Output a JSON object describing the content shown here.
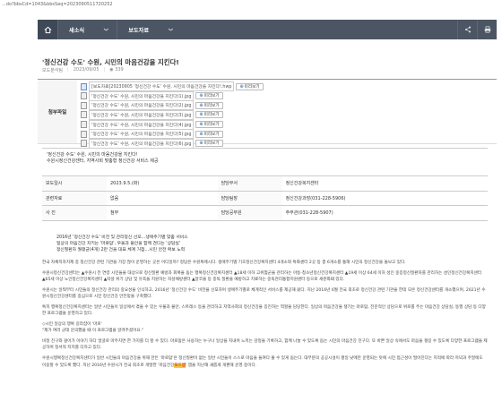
{
  "url": "...do?bbsCd=1043&bbsSeq=2023090511720252",
  "nav": {
    "crumbs": [
      "새소식",
      "보도자료"
    ]
  },
  "article": {
    "title": "'정신건강 수도' 수원, 시민의 마음건강을 지킨다!",
    "department": "보도분석팀",
    "date": "2023/09/05",
    "views": "339"
  },
  "attach": {
    "label": "첨부파일",
    "files": [
      {
        "name": "[보도자료]20230905 '정신건강 수도' 수원, 시민의 마음건강을 지킨다!.hwp",
        "type": "hwp",
        "download": "다운로드",
        "preview": "미리보기"
      },
      {
        "name": "'정신건강 수도' 수원, 시민의 마음건강을 지킨다(1).jpg",
        "type": "jpg",
        "download": "다운로드",
        "preview": "미리보기"
      },
      {
        "name": "'정신건강 수도' 수원, 시민의 마음건강을 지킨다(2).jpg",
        "type": "jpg",
        "download": "다운로드",
        "preview": "미리보기"
      },
      {
        "name": "'정신건강 수도' 수원, 시민의 마음건강을 지킨다(3).jpg",
        "type": "jpg",
        "download": "다운로드",
        "preview": "미리보기"
      },
      {
        "name": "'정신건강 수도' 수원, 시민의 마음건강을 지킨다(4).jpg",
        "type": "jpg",
        "download": "다운로드",
        "preview": "미리보기"
      },
      {
        "name": "'정신건강 수도' 수원, 시민의 마음건강을 지킨다(5).jpg",
        "type": "jpg",
        "download": "다운로드",
        "preview": "미리보기"
      },
      {
        "name": "'정신건강 수도' 수원, 시민의 마음건강을 지킨다(6).jpg",
        "type": "jpg",
        "download": "다운로드",
        "preview": "미리보기"
      }
    ]
  },
  "lead": {
    "line1": "'정신건강 수도' 수원, 시민의 마음건강을 지킨다!",
    "line2": "수원시정신건강센터, 지역사회 맞춤형 정신건강 서비스 제공"
  },
  "info_table": [
    [
      "보도일시",
      "2023.9.5.(화)",
      "담당부서",
      "정신건강복지센터"
    ],
    [
      "관련자료",
      "없음",
      "담당팀장",
      "정신건강과장(031-228-5906)"
    ],
    [
      "사 진",
      "첨부",
      "담당공무원",
      "주무관(031-228-5907)"
    ]
  ],
  "summary": [
    "2016년 '정신건강 수도' 비전 및 관리정신 선포…생애주기별 맞춤 서비스",
    "일상의 마음건강 지키는 '마로맘', 우울과 불안을 함께 견디는 '상담실'",
    "정신질환자 월평균(4개) 2만 건을 대표 체계 거점…시민 안전 확보 노력"
  ],
  "paragraphs": [
    "한국 자체지자치제 중 정신건강 관련 기관을 가장 많이 운영하는 곳은 어디일까? 정답은 수원특례시다. 생애주기별 기초정신건강복지센터 4개소와 특화센터 2곳 등 총 6개소를 통해 시민의 정신건강을 돌보고 있다.",
    "수원시정신건강센터는 ▲수원시 전 연령 시민들을 대상으로 정신질환 예방과 회복을 돕는 행복정신건강복지센터 ▲18세 이하 고위험군을 관리하는 아동·청소년정신건강복지센터 ▲19세 이상 64세 이하 성인 중증정신질환자를 관리하는 성인정신건강복지센터 ▲65세 이상 노인정신건강복지센터 ▲자살 위기 상담 및 유족을 지원하는 자살예방센터 ▲알코올 등 중독 질환을 예방하고 치료하는 중독관리통합지원센터 등으로 세분화돼 있다.",
    "수원시는 일찍부터 시민들의 정신건강 관리의 중요성을 인식하고, 2016년 '정신건강 수도' 비전을 선포하며 생애주기별로 체계적인 서비스를 제공해 왔다. 지난 2016년 6월 전국 최초로 정신건강 관련 기관을 한데 모은 정신건강센터를 개소했으며, 2021년 수원시정신건강센터를 중심으로 시민 정신건강 안전망을 구축했다.",
    "특히 행복정신건강복지센터는 일반 시민들이 일상에서 겪을 수 있는 우울과 불안, 스트레스 등을 관리하고 지역사회의 정신건강을 증진하는 역할을 담당한다. 일상의 마음건강을 챙기는 마로맘, 전문적인 상담으로 위로를 주는 마음건강 상담실, 동행 상담 등 다양한 프로그램을 운영하고 있다.",
    "◇시민 일상의 행복 길라잡이 '마로'\n\"제가 여러 군데 문의했을 때 이 프로그램을 알려주셨어요.\"",
    "비정 친구와 걸어가 이야기 하다 얼굴로 마주치면 한 가지를 더 할 수 있다. 마로맘은 사용하는 누구나 일상을 지내며 느끼는 감정을 기록하고, 함께 나눌 수 있도록 돕는 시민의 마음건강 친구다. 또 바쁜 일상 속에서도 마음을 챙길 수 있도록 다양한 프로그램을 제공하며 정서적 지지를 더하고 있다.",
    "수원시행복정신건강복지센터가 일반 시민들의 마음건강을 위해 만든 '마로맘'은 정신질환이 없는 일반 시민들이 스스로 마음을 들여다 볼 수 있게 돕는다. 대부분의 공공시설이 평일 낮에만 운영되는 탓에 시민 접근성이 떨어진다는 지적에 따라 저녁과 주말에도 이용할 수 있도록 했다. 지난 2016년 수원시가 전국 최초로 개발한 '마음건강|",
    "|' 앱을 지난해 새롭게 개편해 운영 중이다."
  ],
  "highlight": "모드앱"
}
